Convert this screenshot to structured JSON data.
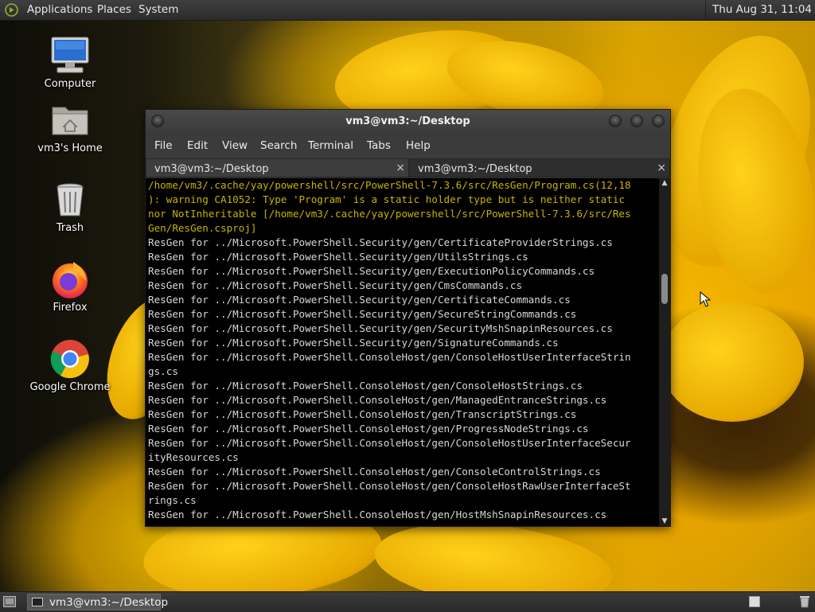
{
  "top_panel": {
    "menus": [
      "Applications",
      "Places",
      "System"
    ],
    "clock": "Thu Aug 31, 11:04"
  },
  "desktop_icons": [
    {
      "label": "Computer",
      "icon": "computer-icon"
    },
    {
      "label": "vm3's Home",
      "icon": "home-folder-icon"
    },
    {
      "label": "Trash",
      "icon": "trash-icon"
    },
    {
      "label": "Firefox",
      "icon": "firefox-icon"
    },
    {
      "label": "Google Chrome",
      "icon": "chrome-icon"
    }
  ],
  "terminal": {
    "title": "vm3@vm3:~/Desktop",
    "menu": [
      "File",
      "Edit",
      "View",
      "Search",
      "Terminal",
      "Tabs",
      "Help"
    ],
    "tabs": [
      {
        "label": "vm3@vm3:~/Desktop",
        "active": true
      },
      {
        "label": "vm3@vm3:~/Desktop",
        "active": false
      }
    ],
    "tab_close": "×",
    "lines": [
      {
        "text": "/home/vm3/.cache/yay/powershell/src/PowerShell-7.3.6/src/ResGen/Program.cs(12,18",
        "warn": true
      },
      {
        "text": "): warning CA1052: Type 'Program' is a static holder type but is neither static",
        "warn": true
      },
      {
        "text": "nor NotInheritable [/home/vm3/.cache/yay/powershell/src/PowerShell-7.3.6/src/Res",
        "warn": true
      },
      {
        "text": "Gen/ResGen.csproj]",
        "warn": true
      },
      {
        "text": "ResGen for ../Microsoft.PowerShell.Security/gen/CertificateProviderStrings.cs",
        "warn": false
      },
      {
        "text": "ResGen for ../Microsoft.PowerShell.Security/gen/UtilsStrings.cs",
        "warn": false
      },
      {
        "text": "ResGen for ../Microsoft.PowerShell.Security/gen/ExecutionPolicyCommands.cs",
        "warn": false
      },
      {
        "text": "ResGen for ../Microsoft.PowerShell.Security/gen/CmsCommands.cs",
        "warn": false
      },
      {
        "text": "ResGen for ../Microsoft.PowerShell.Security/gen/CertificateCommands.cs",
        "warn": false
      },
      {
        "text": "ResGen for ../Microsoft.PowerShell.Security/gen/SecureStringCommands.cs",
        "warn": false
      },
      {
        "text": "ResGen for ../Microsoft.PowerShell.Security/gen/SecurityMshSnapinResources.cs",
        "warn": false
      },
      {
        "text": "ResGen for ../Microsoft.PowerShell.Security/gen/SignatureCommands.cs",
        "warn": false
      },
      {
        "text": "ResGen for ../Microsoft.PowerShell.ConsoleHost/gen/ConsoleHostUserInterfaceStrin",
        "warn": false
      },
      {
        "text": "gs.cs",
        "warn": false
      },
      {
        "text": "ResGen for ../Microsoft.PowerShell.ConsoleHost/gen/ConsoleHostStrings.cs",
        "warn": false
      },
      {
        "text": "ResGen for ../Microsoft.PowerShell.ConsoleHost/gen/ManagedEntranceStrings.cs",
        "warn": false
      },
      {
        "text": "ResGen for ../Microsoft.PowerShell.ConsoleHost/gen/TranscriptStrings.cs",
        "warn": false
      },
      {
        "text": "ResGen for ../Microsoft.PowerShell.ConsoleHost/gen/ProgressNodeStrings.cs",
        "warn": false
      },
      {
        "text": "ResGen for ../Microsoft.PowerShell.ConsoleHost/gen/ConsoleHostUserInterfaceSecur",
        "warn": false
      },
      {
        "text": "ityResources.cs",
        "warn": false
      },
      {
        "text": "ResGen for ../Microsoft.PowerShell.ConsoleHost/gen/ConsoleControlStrings.cs",
        "warn": false
      },
      {
        "text": "ResGen for ../Microsoft.PowerShell.ConsoleHost/gen/ConsoleHostRawUserInterfaceSt",
        "warn": false
      },
      {
        "text": "rings.cs",
        "warn": false
      },
      {
        "text": "ResGen for ../Microsoft.PowerShell.ConsoleHost/gen/HostMshSnapinResources.cs",
        "warn": false
      }
    ],
    "colors": {
      "warning": "#c8b400",
      "text": "#d8d8d8",
      "background": "#000000"
    }
  },
  "bottom_panel": {
    "task_label": "vm3@vm3:~/Desktop"
  }
}
